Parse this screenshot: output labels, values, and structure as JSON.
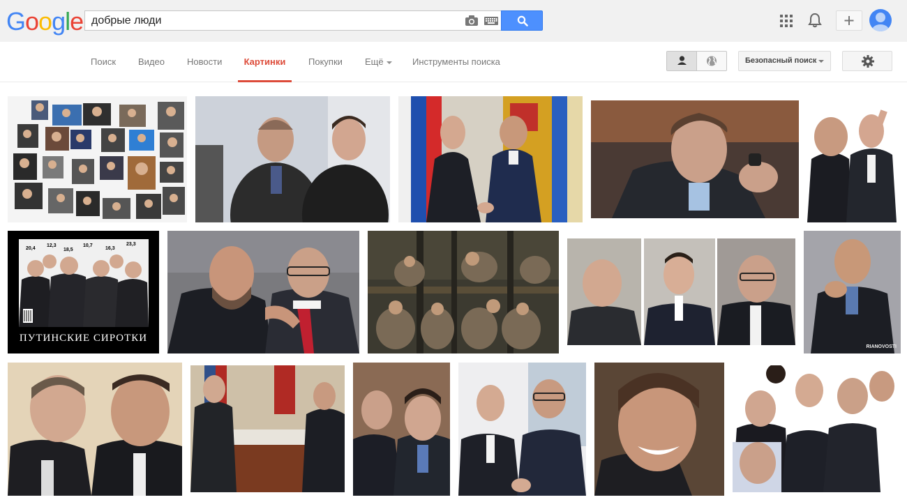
{
  "header": {
    "logo": [
      "G",
      "o",
      "o",
      "g",
      "l",
      "e"
    ],
    "logo_colors": [
      "#4285f4",
      "#ea4335",
      "#fbbc05",
      "#4285f4",
      "#34a853",
      "#ea4335"
    ],
    "search_value": "добрые люди",
    "icons": [
      "camera-icon",
      "keyboard-icon",
      "search-icon",
      "apps-icon",
      "bell-icon",
      "plus-icon",
      "avatar"
    ]
  },
  "nav": {
    "items": [
      "Поиск",
      "Видео",
      "Новости",
      "Картинки",
      "Покупки",
      "Ещё",
      "Инструменты поиска"
    ],
    "active": "Картинки",
    "safesearch_label": "Безопасный поиск"
  },
  "thumbnails": {
    "r2_c1_numbers": [
      "20,4",
      "12,3",
      "18,5",
      "10,7",
      "16,3",
      "23,3"
    ],
    "r2_c1_caption": "ПУТИНСКИЕ СИРОТКИ",
    "r2_c5_watermark": "RIANOVOSTI"
  },
  "colors": {
    "accent_red": "#dd4b39",
    "search_blue": "#4d90fe",
    "topbar_bg": "#f1f1f1"
  }
}
